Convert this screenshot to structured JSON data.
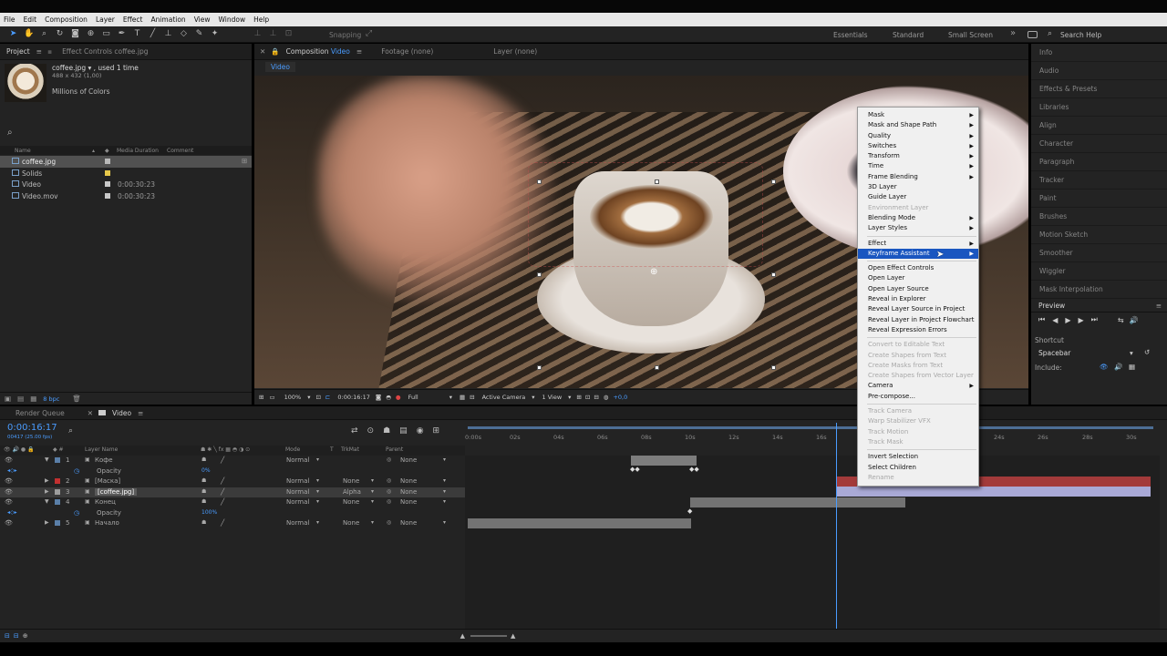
{
  "menubar": [
    "File",
    "Edit",
    "Composition",
    "Layer",
    "Effect",
    "Animation",
    "View",
    "Window",
    "Help"
  ],
  "toolbar": {
    "snapping": "Snapping",
    "workspaces": [
      "Essentials",
      "Standard",
      "Small Screen"
    ],
    "more": "»",
    "search_help": "Search Help"
  },
  "project": {
    "tab_project": "Project",
    "tab_effect_controls": "Effect Controls coffee.jpg",
    "selected_name": "coffee.jpg ▾ , used 1 time",
    "selected_dims": "488 x 432 (1,00)",
    "selected_colors": "Millions of Colors",
    "search_glyph": "⌕",
    "col_name": "Name",
    "col_duration": "Media Duration",
    "col_comment": "Comment",
    "items": [
      {
        "name": "coffee.jpg",
        "duration": "",
        "color": "#b9b9b9"
      },
      {
        "name": "Solids",
        "duration": "",
        "color": "#e6c84a"
      },
      {
        "name": "Video",
        "duration": "0:00:30:23",
        "color": "#c8c8c8"
      },
      {
        "name": "Video.mov",
        "duration": "0:00:30:23",
        "color": "#c8c8c8"
      }
    ],
    "bpc": "8 bpc"
  },
  "viewer": {
    "tab_composition": "Composition",
    "tab_comp_name": "Video",
    "tab_footage": "Footage (none)",
    "tab_layer": "Layer (none)",
    "breadcrumb": "Video",
    "zoom": "100%",
    "timecode": "0:00:16:17",
    "resolution": "Full",
    "camera": "Active Camera",
    "views": "1 View",
    "exposure": "+0,0"
  },
  "right_panels": [
    "Info",
    "Audio",
    "Effects & Presets",
    "Libraries",
    "Align",
    "Character",
    "Paragraph",
    "Tracker",
    "Paint",
    "Brushes",
    "Motion Sketch",
    "Smoother",
    "Wiggler",
    "Mask Interpolation"
  ],
  "preview": {
    "title": "Preview",
    "shortcut_label": "Shortcut",
    "shortcut_value": "Spacebar",
    "include_label": "Include:"
  },
  "context_menu": {
    "groups": [
      [
        {
          "label": "Mask",
          "sub": true,
          "disabled": false
        },
        {
          "label": "Mask and Shape Path",
          "sub": true,
          "disabled": false
        },
        {
          "label": "Quality",
          "sub": true,
          "disabled": false
        },
        {
          "label": "Switches",
          "sub": true,
          "disabled": false
        },
        {
          "label": "Transform",
          "sub": true,
          "disabled": false
        },
        {
          "label": "Time",
          "sub": true,
          "disabled": false
        },
        {
          "label": "Frame Blending",
          "sub": true,
          "disabled": false
        },
        {
          "label": "3D Layer",
          "sub": false,
          "disabled": false
        },
        {
          "label": "Guide Layer",
          "sub": false,
          "disabled": false
        },
        {
          "label": "Environment Layer",
          "sub": false,
          "disabled": true
        },
        {
          "label": "Blending Mode",
          "sub": true,
          "disabled": false
        },
        {
          "label": "Layer Styles",
          "sub": true,
          "disabled": false
        }
      ],
      [
        {
          "label": "Effect",
          "sub": true,
          "disabled": false
        },
        {
          "label": "Keyframe Assistant",
          "sub": true,
          "disabled": false,
          "highlight": true
        }
      ],
      [
        {
          "label": "Open Effect Controls",
          "sub": false,
          "disabled": false
        },
        {
          "label": "Open Layer",
          "sub": false,
          "disabled": false
        },
        {
          "label": "Open Layer Source",
          "sub": false,
          "disabled": false
        },
        {
          "label": "Reveal in Explorer",
          "sub": false,
          "disabled": false
        },
        {
          "label": "Reveal Layer Source in Project",
          "sub": false,
          "disabled": false
        },
        {
          "label": "Reveal Layer in Project Flowchart",
          "sub": false,
          "disabled": false
        },
        {
          "label": "Reveal Expression Errors",
          "sub": false,
          "disabled": false
        }
      ],
      [
        {
          "label": "Convert to Editable Text",
          "sub": false,
          "disabled": true
        },
        {
          "label": "Create Shapes from Text",
          "sub": false,
          "disabled": true
        },
        {
          "label": "Create Masks from Text",
          "sub": false,
          "disabled": true
        },
        {
          "label": "Create Shapes from Vector Layer",
          "sub": false,
          "disabled": true
        },
        {
          "label": "Camera",
          "sub": true,
          "disabled": false
        },
        {
          "label": "Pre-compose...",
          "sub": false,
          "disabled": false
        }
      ],
      [
        {
          "label": "Track Camera",
          "sub": false,
          "disabled": true
        },
        {
          "label": "Warp Stabilizer VFX",
          "sub": false,
          "disabled": true
        },
        {
          "label": "Track Motion",
          "sub": false,
          "disabled": true
        },
        {
          "label": "Track Mask",
          "sub": false,
          "disabled": true
        }
      ],
      [
        {
          "label": "Invert Selection",
          "sub": false,
          "disabled": false
        },
        {
          "label": "Select Children",
          "sub": false,
          "disabled": false
        },
        {
          "label": "Rename",
          "sub": false,
          "disabled": true
        }
      ]
    ]
  },
  "timeline": {
    "tab_render_queue": "Render Queue",
    "tab_comp": "Video",
    "timecode": "0:00:16:17",
    "fps": "00417 (25.00 fps)",
    "col_layer_name": "Layer Name",
    "col_mode": "Mode",
    "col_t": "T",
    "col_trkmat": "TrkMat",
    "col_parent": "Parent",
    "ruler": [
      "0:00s",
      "02s",
      "04s",
      "06s",
      "08s",
      "10s",
      "12s",
      "14s",
      "16s",
      "24s",
      "26s",
      "28s",
      "30s"
    ],
    "rows": [
      {
        "num": "1",
        "name": "Кофе",
        "label": "#5a7fa8",
        "mode": "Normal",
        "trk": "",
        "parent": "None"
      },
      {
        "num": "",
        "name": "Opacity",
        "value": "0%",
        "prop": true
      },
      {
        "num": "2",
        "name": "[Маска]",
        "label": "#c23030",
        "mode": "Normal",
        "trk": "None",
        "parent": "None"
      },
      {
        "num": "3",
        "name": "[coffee.jpg]",
        "label": "#9d9d9d",
        "mode": "Normal",
        "trk": "Alpha",
        "parent": "None",
        "selected": true
      },
      {
        "num": "4",
        "name": "Конец",
        "label": "#5a7fa8",
        "mode": "Normal",
        "trk": "None",
        "parent": "None"
      },
      {
        "num": "",
        "name": "Opacity",
        "value": "100%",
        "prop": true
      },
      {
        "num": "5",
        "name": "Начало",
        "label": "#5a7fa8",
        "mode": "Normal",
        "trk": "None",
        "parent": "None"
      }
    ]
  }
}
